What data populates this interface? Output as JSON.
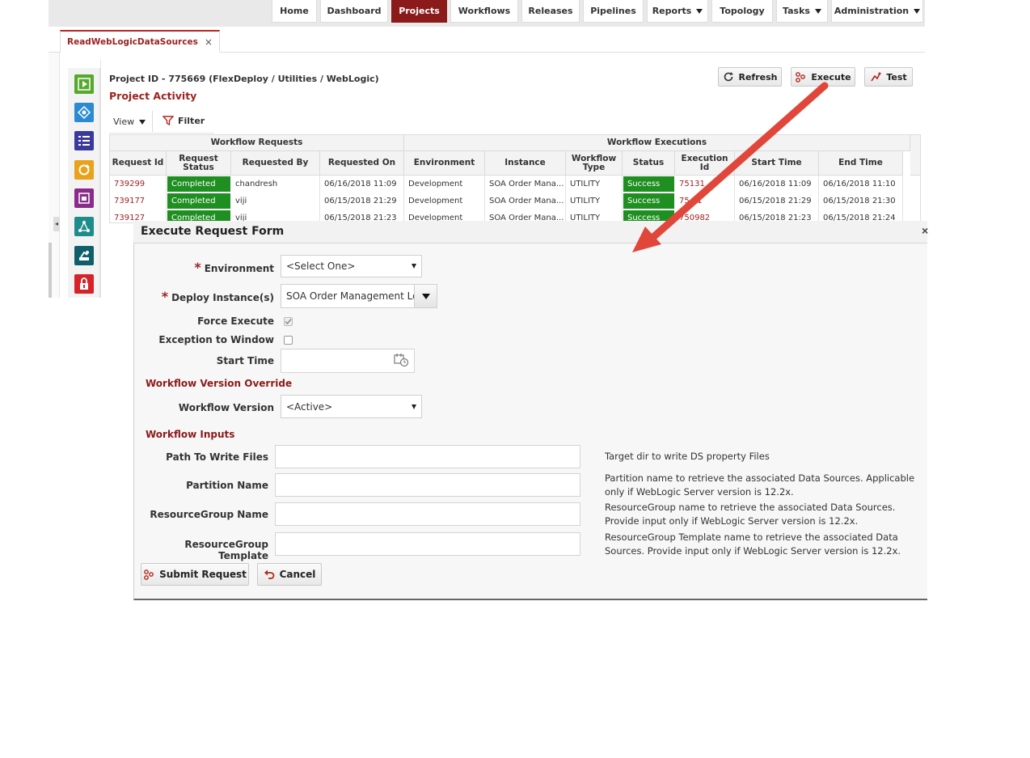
{
  "nav": {
    "tabs": [
      {
        "label": "Home",
        "active": false,
        "dropdown": false
      },
      {
        "label": "Dashboard",
        "active": false,
        "dropdown": false
      },
      {
        "label": "Projects",
        "active": true,
        "dropdown": false
      },
      {
        "label": "Workflows",
        "active": false,
        "dropdown": false
      },
      {
        "label": "Releases",
        "active": false,
        "dropdown": false
      },
      {
        "label": "Pipelines",
        "active": false,
        "dropdown": false
      },
      {
        "label": "Reports",
        "active": false,
        "dropdown": true
      },
      {
        "label": "Topology",
        "active": false,
        "dropdown": false
      },
      {
        "label": "Tasks",
        "active": false,
        "dropdown": true
      },
      {
        "label": "Administration",
        "active": false,
        "dropdown": true
      }
    ]
  },
  "doc_tab": {
    "label": "ReadWebLogicDataSources",
    "close": "×"
  },
  "sidebar": {
    "icons": [
      {
        "name": "execute-icon",
        "color": "#57a92e"
      },
      {
        "name": "workflow-icon",
        "color": "#2a8ad2"
      },
      {
        "name": "list-icon",
        "color": "#3a3a9c"
      },
      {
        "name": "sync-icon",
        "color": "#e9a21c"
      },
      {
        "name": "report-icon",
        "color": "#8a2a8a"
      },
      {
        "name": "topology-icon",
        "color": "#1f8c8c"
      },
      {
        "name": "deploy-icon",
        "color": "#0f5f6a"
      },
      {
        "name": "lock-icon",
        "color": "#d6232a"
      }
    ]
  },
  "project": {
    "id_line": "Project ID - 775669 (FlexDeploy / Utilities / WebLogic)",
    "activity_title": "Project Activity"
  },
  "actions": {
    "refresh": "Refresh",
    "execute": "Execute",
    "test": "Test"
  },
  "toolbar": {
    "view": "View",
    "filter": "Filter"
  },
  "grid": {
    "group_headers": {
      "requests": "Workflow Requests",
      "executions": "Workflow Executions"
    },
    "columns": [
      "Request Id",
      "Request Status",
      "Requested By",
      "Requested On",
      "Environment",
      "Instance",
      "Workflow Type",
      "Status",
      "Execution Id",
      "Start Time",
      "End Time"
    ],
    "rows": [
      {
        "request_id": "739299",
        "request_status": "Completed",
        "requested_by": "chandresh",
        "requested_on": "06/16/2018 11:09",
        "environment": "Development",
        "instance": "SOA Order Mana...",
        "workflow_type": "UTILITY",
        "status": "Success",
        "execution_id": "75131",
        "start_time": "06/16/2018 11:09",
        "end_time": "06/16/2018 11:10"
      },
      {
        "request_id": "739177",
        "request_status": "Completed",
        "requested_by": "viji",
        "requested_on": "06/15/2018 21:29",
        "environment": "Development",
        "instance": "SOA Order Mana...",
        "workflow_type": "UTILITY",
        "status": "Success",
        "execution_id": "75 01",
        "start_time": "06/15/2018 21:29",
        "end_time": "06/15/2018 21:30"
      },
      {
        "request_id": "739127",
        "request_status": "Completed",
        "requested_by": "viji",
        "requested_on": "06/15/2018 21:23",
        "environment": "Development",
        "instance": "SOA Order Mana...",
        "workflow_type": "UTILITY",
        "status": "Success",
        "execution_id": "750982",
        "start_time": "06/15/2018 21:23",
        "end_time": "06/15/2018 21:24"
      }
    ]
  },
  "modal": {
    "title": "Execute Request Form",
    "close": "×",
    "environment": {
      "label": "Environment",
      "value": "<Select One>"
    },
    "deploy_instances": {
      "label": "Deploy Instance(s)",
      "value": "SOA Order Management Loca"
    },
    "force_execute": {
      "label": "Force Execute",
      "checked": true
    },
    "exception_to_window": {
      "label": "Exception to Window",
      "checked": false
    },
    "start_time": {
      "label": "Start Time",
      "value": ""
    },
    "version_section": "Workflow Version Override",
    "workflow_version": {
      "label": "Workflow Version",
      "value": "<Active>"
    },
    "inputs_section": "Workflow Inputs",
    "inputs": [
      {
        "label": "Path To Write Files",
        "value": "",
        "hint": "Target dir to write DS  property Files"
      },
      {
        "label": "Partition Name",
        "value": "",
        "hint": "Partition name to retrieve the associated Data Sources. Applicable only if WebLogic Server version is 12.2x."
      },
      {
        "label": "ResourceGroup Name",
        "value": "",
        "hint": "ResourceGroup name to retrieve the associated Data Sources. Provide input only if WebLogic Server version is 12.2x."
      },
      {
        "label": "ResourceGroup Template",
        "value": "",
        "hint": "ResourceGroup Template name to retrieve the associated Data Sources. Provide input only if WebLogic Server version is 12.2x."
      }
    ],
    "submit": "Submit Request",
    "cancel": "Cancel"
  },
  "colors": {
    "brand": "#8b1a1a",
    "success": "#1f8f21",
    "annotation_arrow": "#e0473a"
  }
}
